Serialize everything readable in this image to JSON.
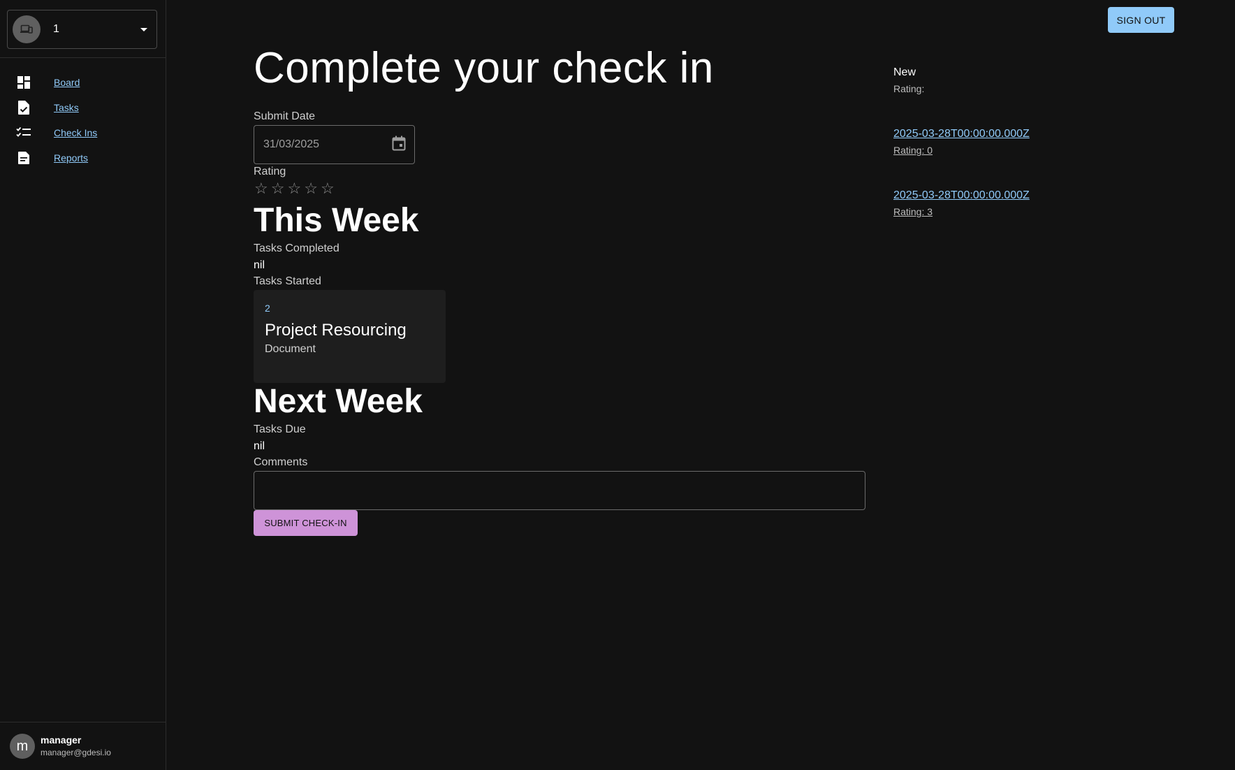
{
  "sidebar": {
    "workspace": {
      "value": "1"
    },
    "nav": [
      {
        "label": "Board",
        "icon": "dashboard-icon"
      },
      {
        "label": "Tasks",
        "icon": "task-icon"
      },
      {
        "label": "Check Ins",
        "icon": "checklist-icon"
      },
      {
        "label": "Reports",
        "icon": "report-icon"
      }
    ],
    "user": {
      "initial": "m",
      "name": "manager",
      "email": "manager@gdesi.io"
    }
  },
  "header": {
    "signout_label": "SIGN OUT"
  },
  "main": {
    "title": "Complete your check in",
    "submit_date": {
      "label": "Submit Date",
      "value": "31/03/2025"
    },
    "rating": {
      "label": "Rating",
      "value": 0,
      "max": 5
    },
    "this_week": {
      "title": "This Week",
      "tasks_completed_label": "Tasks Completed",
      "tasks_completed_value": "nil",
      "tasks_started_label": "Tasks Started",
      "tasks_started": [
        {
          "id": "2",
          "title": "Project Resourcing",
          "type": "Document"
        }
      ]
    },
    "next_week": {
      "title": "Next Week",
      "tasks_due_label": "Tasks Due",
      "tasks_due_value": "nil"
    },
    "comments": {
      "label": "Comments",
      "value": ""
    },
    "submit_label": "SUBMIT CHECK-IN"
  },
  "history": [
    {
      "title": "New",
      "rating": "Rating:",
      "link": false
    },
    {
      "title": "2025-03-28T00:00:00.000Z",
      "rating": "Rating: 0",
      "link": true
    },
    {
      "title": "2025-03-28T00:00:00.000Z",
      "rating": "Rating: 3",
      "link": true
    }
  ],
  "colors": {
    "background": "#121212",
    "accent_blue": "#90caf9",
    "accent_purple": "#ce93d8",
    "card": "#1e1e1e"
  }
}
